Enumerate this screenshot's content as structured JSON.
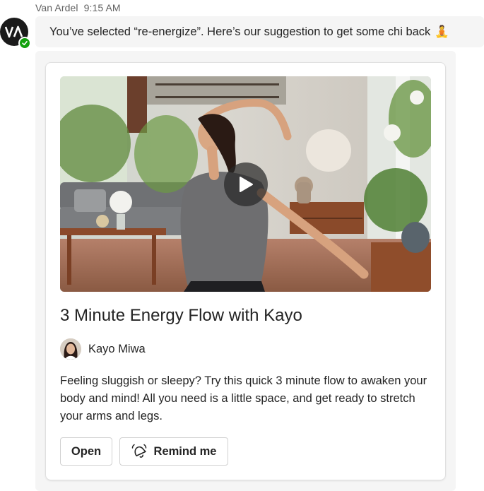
{
  "message": {
    "sender": "Van Ardel",
    "time": "9:15 AM",
    "avatar_initials": "VA",
    "text": "You’ve selected “re-energize”.  Here’s our suggestion to get some chi back",
    "emoji": "🧘"
  },
  "card": {
    "title": "3 Minute Energy Flow with Kayo",
    "author": "Kayo Miwa",
    "description": "Feeling sluggish or sleepy? Try this quick 3 minute flow to awaken your body and mind! All you need is a little space, and get ready to stretch your arms and legs.",
    "buttons": {
      "open": "Open",
      "remind": "Remind me"
    }
  },
  "colors": {
    "presence": "#13a10e",
    "bubble_bg": "#f5f5f5"
  },
  "icons": [
    "avatar-va",
    "check-icon",
    "play-icon",
    "remind-icon"
  ]
}
